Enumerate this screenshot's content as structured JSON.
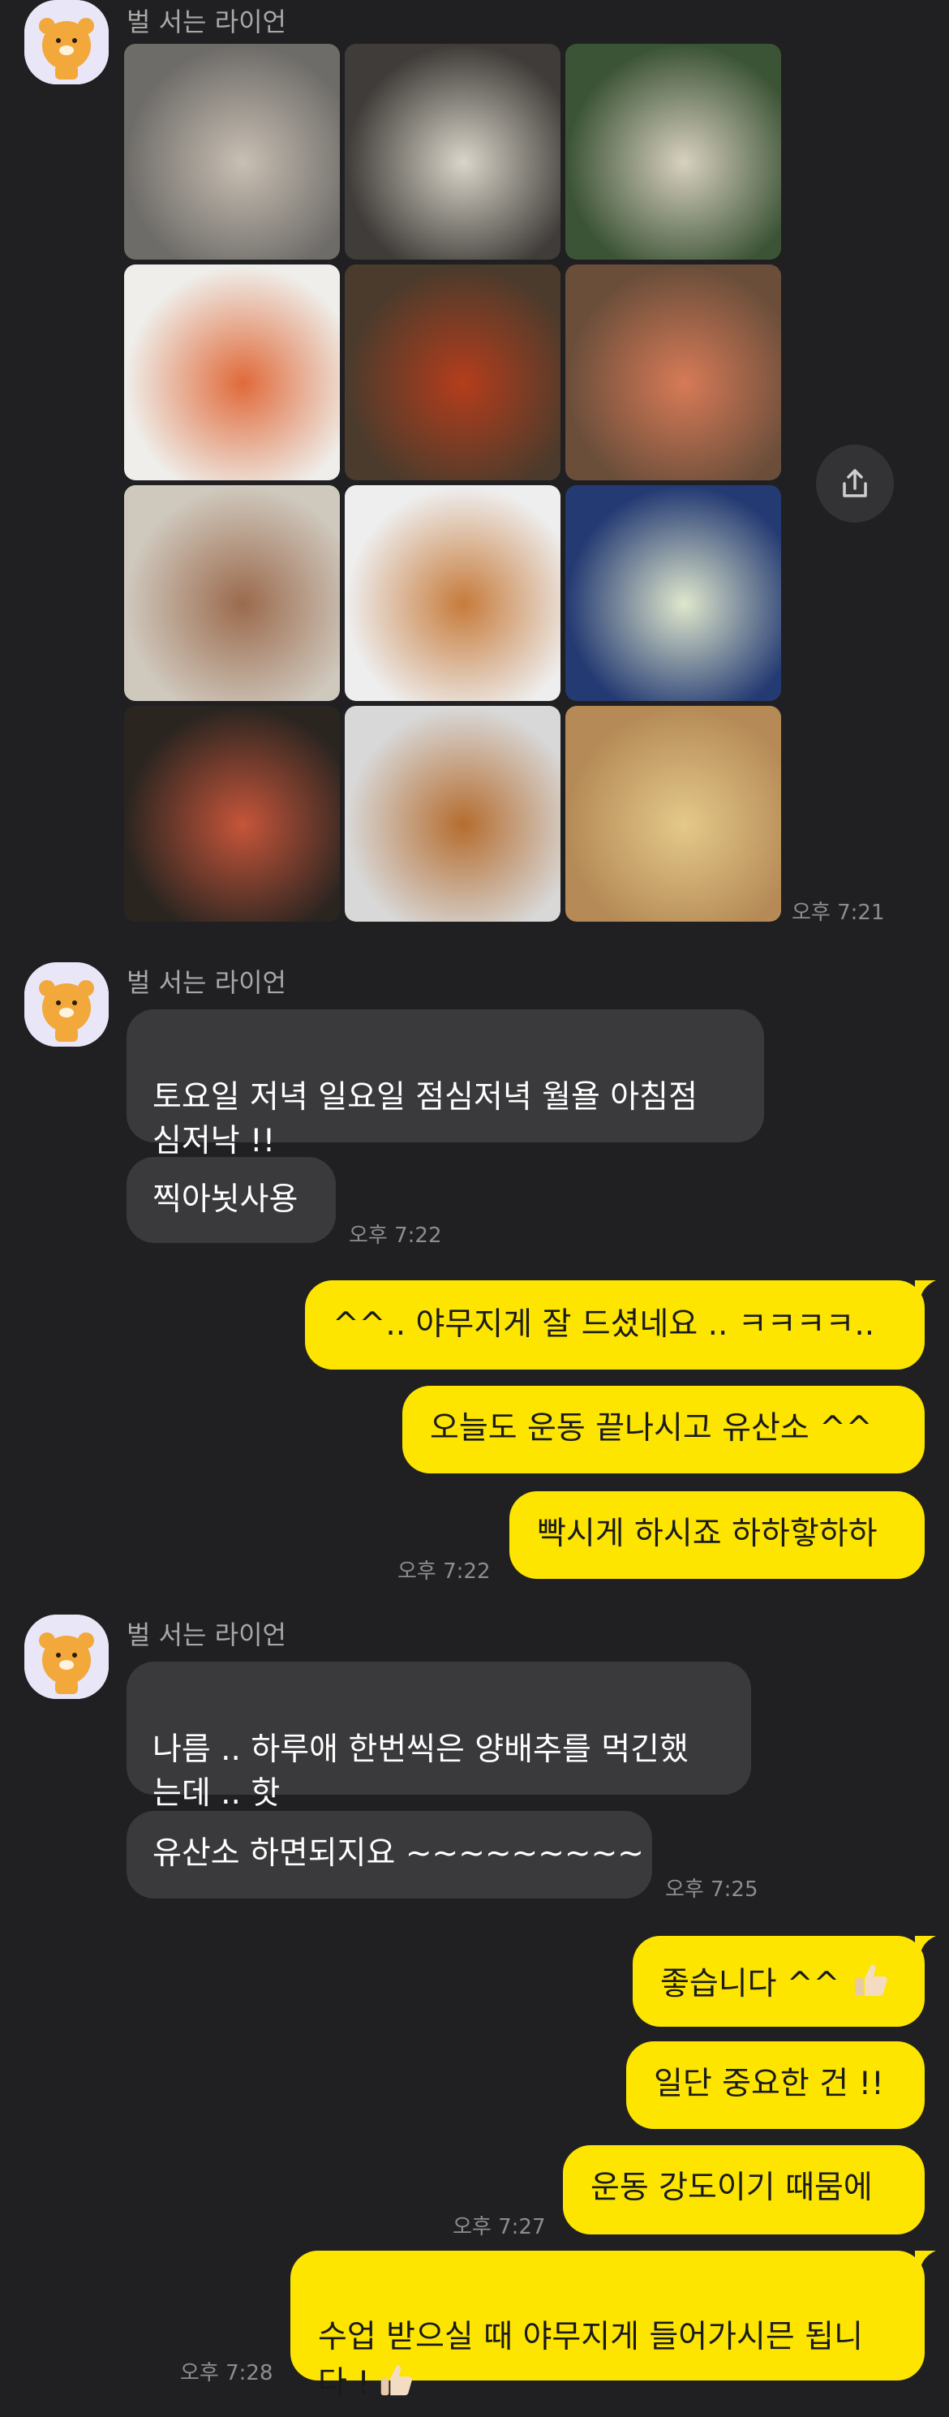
{
  "sender_name": "벌 서는 라이언",
  "photo_group": {
    "time": "오후 7:21",
    "photos": [
      {
        "name": "photo-cafe-dessert",
        "c1": "#6e6c69",
        "c2": "#c9bfb3"
      },
      {
        "name": "photo-gukbap",
        "c1": "#3f3c39",
        "c2": "#d9d5c9"
      },
      {
        "name": "photo-noodle-salad",
        "c1": "#3c5436",
        "c2": "#d8d0c0"
      },
      {
        "name": "photo-salmon-rolls",
        "c1": "#efeeea",
        "c2": "#e06a3a"
      },
      {
        "name": "photo-seafood-pasta",
        "c1": "#4a3b2c",
        "c2": "#b43d1c"
      },
      {
        "name": "photo-bread-soup",
        "c1": "#6a4e3a",
        "c2": "#d77a57"
      },
      {
        "name": "photo-toast-eggs",
        "c1": "#cfc8bd",
        "c2": "#9b6a4c"
      },
      {
        "name": "photo-bun",
        "c1": "#eeeeee",
        "c2": "#c77b3b"
      },
      {
        "name": "photo-cabbage-plate",
        "c1": "#243a73",
        "c2": "#dfe7cc"
      },
      {
        "name": "photo-jjajang",
        "c1": "#2b2520",
        "c2": "#c6553a"
      },
      {
        "name": "photo-fried-chicken",
        "c1": "#d8d8d8",
        "c2": "#b56d2f"
      },
      {
        "name": "photo-cheese-balls",
        "c1": "#b58a56",
        "c2": "#e4c98a"
      }
    ]
  },
  "groups": [
    {
      "messages": [
        "토요일 저녁 일요일 점심저녁 월욜 아침점\n심저낙 !!",
        "찍아뇟사용"
      ],
      "time": "오후 7:22"
    },
    {
      "messages": [
        "^^.. 야무지게 잘 드셨네요 .. ㅋㅋㅋㅋ..",
        "오늘도 운동 끝나시고 유산소 ^^",
        "빡시게 하시죠 하하핳하하"
      ],
      "time": "오후 7:22"
    },
    {
      "messages": [
        "나름 .. 하루애 한번씩은 양배추를 먹긴했\n는데 .. 핫",
        "유산소 하면되지요 ~~~~~~~~~"
      ],
      "time": "오후 7:25"
    },
    {
      "messages": [
        "좋습니다 ^^",
        "일단 중요한 건 !!",
        "운동 강도이기 때뭄에"
      ],
      "time": "오후 7:27"
    },
    {
      "messages": [
        "수업 받으실 때 야무지게 들어가시믄 됩니\n다 !"
      ],
      "time": "오후 7:28"
    }
  ],
  "colors": {
    "background": "#202022",
    "incoming_bubble": "#3a3a3c",
    "outgoing_bubble": "#fde500"
  },
  "icons": [
    "ryan-avatar",
    "share-icon",
    "thumbs-up-emoji"
  ]
}
